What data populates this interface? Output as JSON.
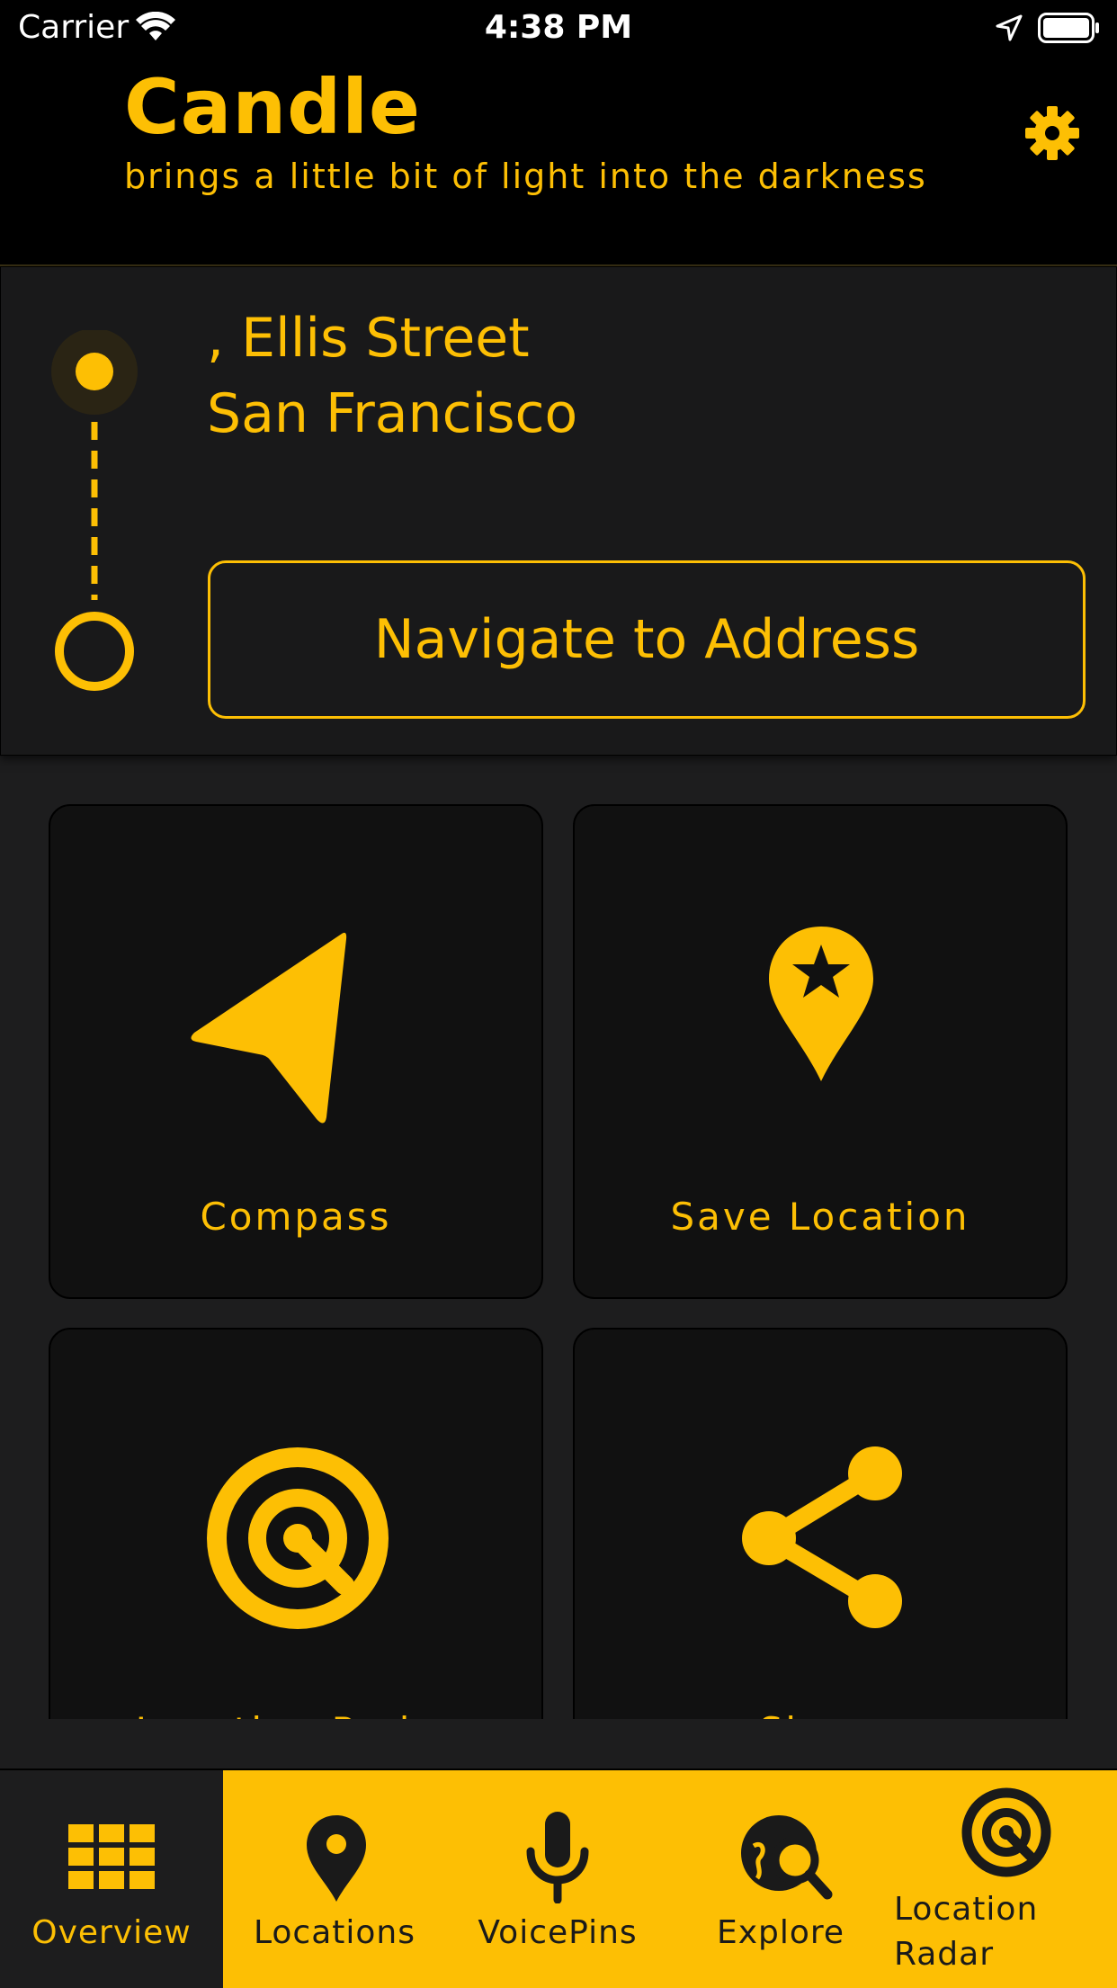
{
  "status_bar": {
    "carrier": "Carrier",
    "time": "4:38 PM"
  },
  "header": {
    "title": "Candle",
    "subtitle": "brings a little bit of light into the darkness"
  },
  "address": {
    "line1": ", Ellis Street",
    "line2": "San Francisco",
    "navigate_label": "Navigate to Address"
  },
  "tiles": [
    {
      "label": "Compass",
      "icon": "navigation-arrow-icon"
    },
    {
      "label": "Save Location",
      "icon": "pin-star-icon"
    },
    {
      "label": "Location Radar",
      "icon": "radar-icon"
    },
    {
      "label": "Share",
      "icon": "share-icon"
    }
  ],
  "tab_bar": {
    "items": [
      {
        "label": "Overview",
        "icon": "grid-icon",
        "active": true
      },
      {
        "label": "Locations",
        "icon": "map-pin-icon"
      },
      {
        "label": "VoicePins",
        "icon": "microphone-icon"
      },
      {
        "label": "Explore",
        "icon": "globe-search-icon"
      },
      {
        "label_line1": "Location",
        "label_line2": "Radar",
        "icon": "radar-icon"
      }
    ]
  },
  "colors": {
    "accent": "#fdbf04",
    "background": "#1d1d1e",
    "header": "#000000",
    "tile": "#111111"
  }
}
